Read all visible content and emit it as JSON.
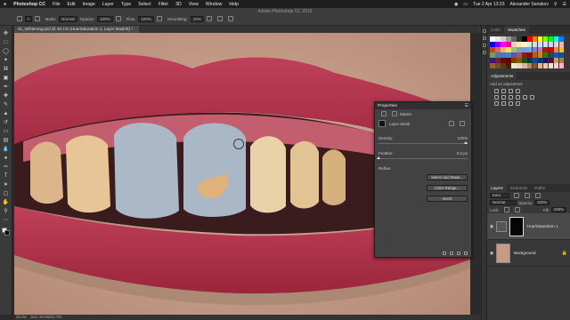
{
  "menubar": {
    "apple": "",
    "app": "Photoshop CC",
    "items": [
      "File",
      "Edit",
      "Image",
      "Layer",
      "Type",
      "Select",
      "Filter",
      "3D",
      "View",
      "Window",
      "Help"
    ],
    "clock": "Tue 2 Apr  13:23",
    "user": "Alexander Seriakov"
  },
  "window_title": "Adobe Photoshop CC 2019",
  "options": {
    "mode_label": "Mode:",
    "mode_value": "Normal",
    "opacity_label": "Opacity:",
    "opacity_value": "100%",
    "flow_label": "Flow:",
    "flow_value": "100%",
    "smoothing_label": "Smoothing:",
    "smoothing_value": "10%"
  },
  "document_tab": "01_Whitening.psd @ 40.1% (Hue/Saturation 1, Layer Mask/8) *",
  "status": {
    "zoom": "40.1%",
    "doc": "Doc: 20.6M/42.7M"
  },
  "swatches_panel": {
    "tabs": [
      "Color",
      "Swatches"
    ],
    "active": "Swatches",
    "colors": [
      "#ffffff",
      "#e6e6e6",
      "#cccccc",
      "#999999",
      "#666666",
      "#333333",
      "#000000",
      "#ff0000",
      "#ff8000",
      "#ffff00",
      "#80ff00",
      "#00ff00",
      "#00ffff",
      "#0080ff",
      "#0000ff",
      "#8000ff",
      "#ff00ff",
      "#ff0080",
      "#f4c7c3",
      "#fce8b2",
      "#fff2cc",
      "#d9ead3",
      "#d0e0e3",
      "#c9daf8",
      "#cfe2f3",
      "#d9d2e9",
      "#ead1dc",
      "#e6b8af",
      "#cc4125",
      "#e06666",
      "#f6b26b",
      "#ffd966",
      "#93c47d",
      "#76a5af",
      "#6d9eeb",
      "#6fa8dc",
      "#8e7cc3",
      "#c27ba0",
      "#a61c00",
      "#cc0000",
      "#e69138",
      "#f1c232",
      "#6aa84f",
      "#45818e",
      "#3c78d8",
      "#3d85c6",
      "#674ea7",
      "#a64d79",
      "#85200c",
      "#990000",
      "#b45f06",
      "#bf9000",
      "#38761d",
      "#134f5c",
      "#1155cc",
      "#0b5394",
      "#351c75",
      "#741b47",
      "#5b0f00",
      "#660000",
      "#783f04",
      "#7f6000",
      "#274e13",
      "#0c343d",
      "#1c4587",
      "#073763",
      "#20124d",
      "#4c1130",
      "#c69c6d",
      "#a67c52",
      "#8c6239",
      "#754c24",
      "#603813",
      "#42210b",
      "#f5e6d3",
      "#ead7c2",
      "#d8b799",
      "#b08968",
      "#7f5539",
      "#ddb892",
      "#e6ccb2",
      "#ede0d4",
      "#ffccd5",
      "#ffb3c1"
    ]
  },
  "adjustments_panel": {
    "title": "Adjustments",
    "hint": "Add an adjustment"
  },
  "layers_panel": {
    "tabs": [
      "Layers",
      "Channels",
      "Paths"
    ],
    "active": "Layers",
    "filter": "Kind",
    "blend": "Normal",
    "opacity_label": "Opacity:",
    "opacity_value": "100%",
    "lock_label": "Lock:",
    "fill_label": "Fill:",
    "fill_value": "100%",
    "layers": [
      {
        "name": "Hue/Saturation 1",
        "selected": true
      },
      {
        "name": "Background",
        "selected": false
      }
    ]
  },
  "properties": {
    "title": "Properties",
    "subtitle": "Masks",
    "mask_label": "Layer Mask",
    "density_label": "Density:",
    "density_value": "100%",
    "density_level": 1.0,
    "feather_label": "Feather:",
    "feather_value": "0.0 px",
    "feather_level": 0.0,
    "refine_label": "Refine:",
    "buttons": [
      "Select and Mask...",
      "Color Range...",
      "Invert"
    ]
  },
  "colors": {
    "lip": "#b5334a",
    "lip_dark": "#8f2236",
    "skin": "#c9a38f",
    "mask_blue": "#aab8c8",
    "tooth_yellow": "#e8c597",
    "gum": "#c25e6e",
    "mouth_dark": "#3b1c1e"
  }
}
